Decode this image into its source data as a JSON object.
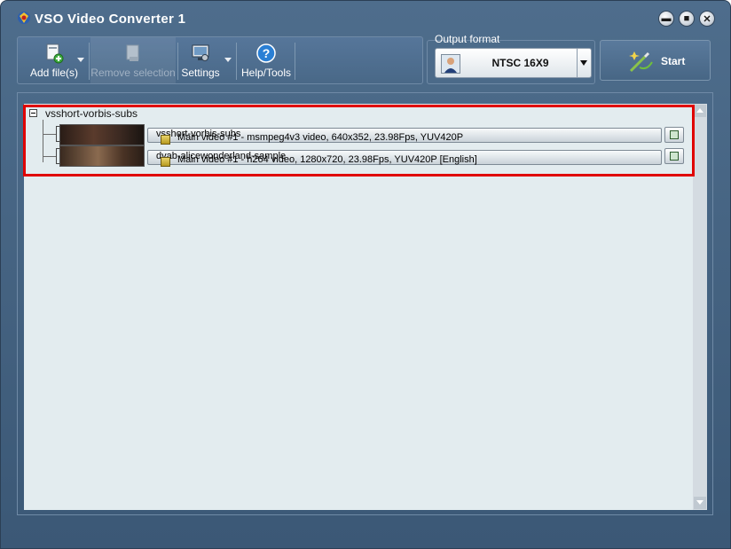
{
  "window": {
    "title": "VSO Video Converter 1"
  },
  "toolbar": {
    "add_files": "Add file(s)",
    "remove_selection": "Remove selection",
    "settings": "Settings",
    "help_tools": "Help/Tools"
  },
  "output_format": {
    "label": "Output format",
    "value": "NTSC 16X9"
  },
  "start": {
    "label": "Start"
  },
  "files": {
    "group_label": "vsshort-vorbis-subs",
    "items": [
      {
        "name": "vsshort-vorbis-subs",
        "info": "Main video #1 - msmpeg4v3 video, 640x352, 23.98Fps, YUV420P"
      },
      {
        "name": "dvab-alicewonderland-sample",
        "info": "Main video #1 - h264 video, 1280x720, 23.98Fps, YUV420P [English]"
      }
    ]
  }
}
